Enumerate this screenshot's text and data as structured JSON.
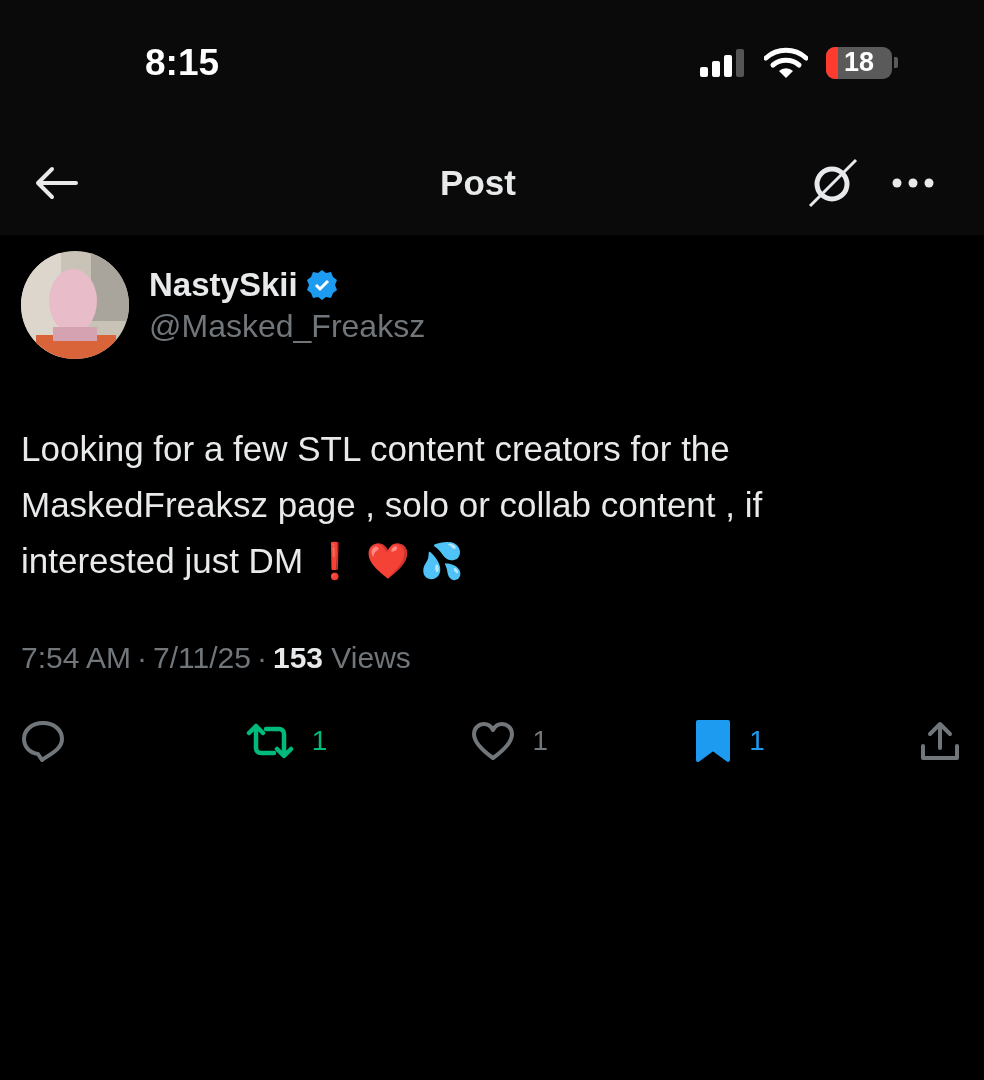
{
  "status_bar": {
    "time": "8:15",
    "battery": "18"
  },
  "nav": {
    "title": "Post"
  },
  "post": {
    "author": {
      "name": "NastySkii",
      "verified": true,
      "handle": "@Masked_Freaksz"
    },
    "text": "Looking for a few STL content creators for the MaskedFreaksz page , solo or collab content , if interested just DM ❗ ❤️ 💦",
    "meta": {
      "time": "7:54 AM",
      "separator_1": "·",
      "date": "7/11/25",
      "separator_2": "·",
      "views_count": "153",
      "views_label": "Views"
    },
    "actions": [
      {
        "kind": "reply",
        "active": false
      },
      {
        "kind": "repost",
        "active": true,
        "count": "1"
      },
      {
        "kind": "like",
        "active": false,
        "count": "1"
      },
      {
        "kind": "bookmark",
        "active": true,
        "count": "1"
      },
      {
        "kind": "share",
        "active": false
      }
    ]
  }
}
